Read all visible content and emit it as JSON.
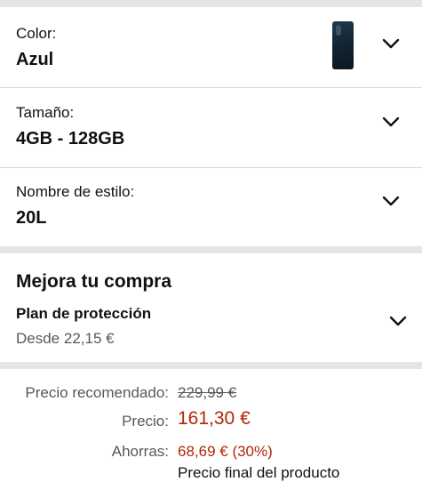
{
  "variants": [
    {
      "label": "Color:",
      "value": "Azul"
    },
    {
      "label": "Tamaño:",
      "value": "4GB - 128GB"
    },
    {
      "label": "Nombre de estilo:",
      "value": "20L"
    }
  ],
  "upgrade": {
    "heading": "Mejora tu compra",
    "plan_title": "Plan de protección",
    "plan_price": "Desde 22,15 €"
  },
  "pricing": {
    "list_label": "Precio recomendado:",
    "list_value": "229,99 €",
    "price_label": "Precio:",
    "price_value": "161,30 €",
    "savings_label": "Ahorras:",
    "savings_value": "68,69 € (30%)",
    "truncated_line": "Precio final del producto"
  },
  "colors": {
    "accent_price": "#b12704",
    "divider": "#e3e6e6"
  },
  "icons": {
    "chevron": "chevron-down-icon",
    "thumbnail": "phone-thumbnail"
  }
}
